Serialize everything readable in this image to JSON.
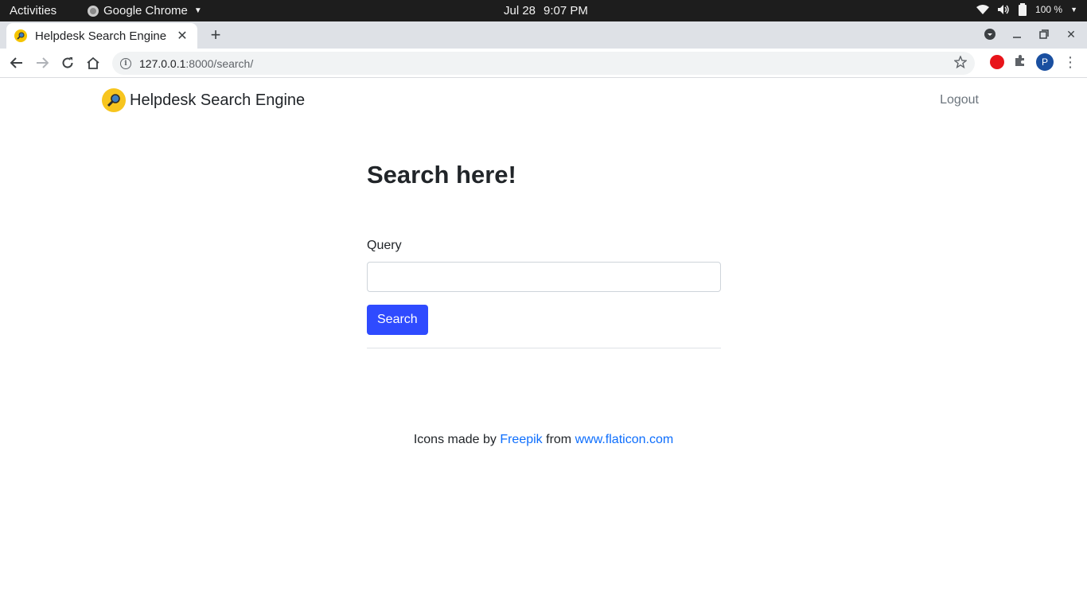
{
  "os_bar": {
    "activities": "Activities",
    "app_name": "Google Chrome",
    "date": "Jul 28",
    "time": "9:07 PM",
    "battery": "100 %"
  },
  "browser": {
    "tab_title": "Helpdesk Search Engine",
    "url_host": "127.0.0.1",
    "url_path": ":8000/search/",
    "profile_initial": "P"
  },
  "navbar": {
    "brand": "Helpdesk Search Engine",
    "logout": "Logout"
  },
  "main": {
    "heading": "Search here!",
    "query_label": "Query",
    "query_value": "",
    "search_button": "Search"
  },
  "footer": {
    "prefix": "Icons made by ",
    "freepik": "Freepik",
    "middle": " from ",
    "flaticon": "www.flaticon.com"
  },
  "colors": {
    "primary_button": "#2f4bff",
    "link": "#0d6efd",
    "logo": "#f7c51e"
  }
}
